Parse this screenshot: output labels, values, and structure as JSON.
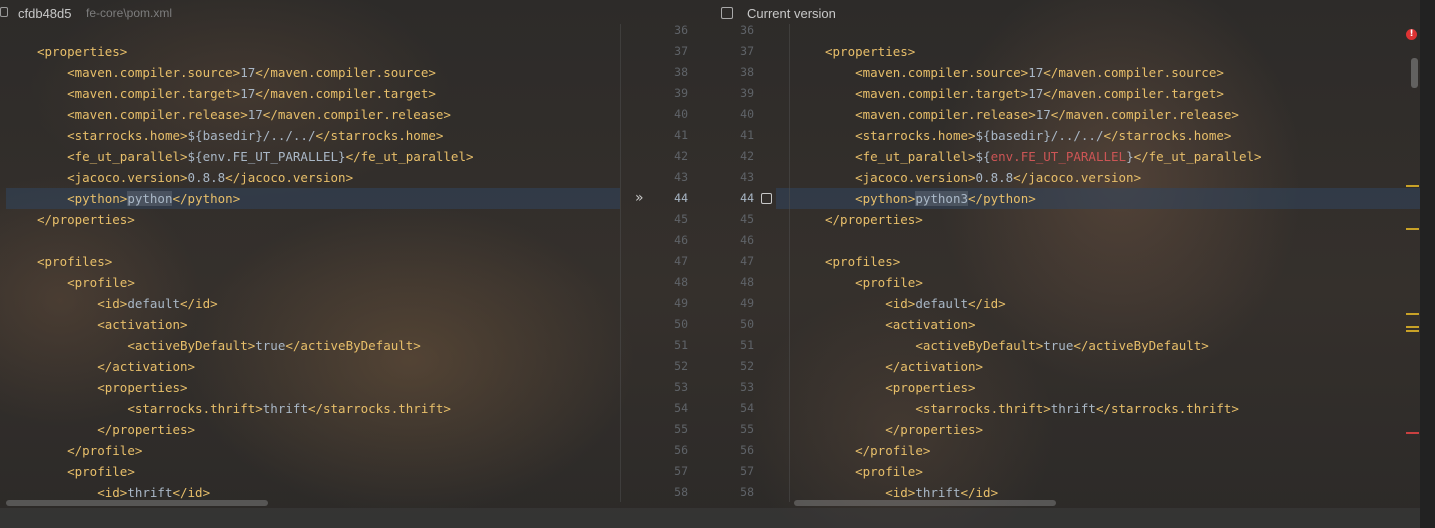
{
  "header": {
    "revision": "cfdb48d5",
    "path": "fe-core\\pom.xml",
    "current_version_label": "Current version"
  },
  "gutter": {
    "left_numbers": [
      "36",
      "37",
      "38",
      "39",
      "40",
      "41",
      "42",
      "43",
      "44",
      "45",
      "46",
      "47",
      "48",
      "49",
      "50",
      "51",
      "52",
      "53",
      "54",
      "55",
      "56",
      "57",
      "58"
    ],
    "right_numbers": [
      "36",
      "37",
      "38",
      "39",
      "40",
      "41",
      "42",
      "43",
      "44",
      "45",
      "46",
      "47",
      "48",
      "49",
      "50",
      "51",
      "52",
      "53",
      "54",
      "55",
      "56",
      "57",
      "58"
    ],
    "current_line": "44"
  },
  "left_lines": [
    {
      "indent": "",
      "parts": []
    },
    {
      "indent": "",
      "parts": [
        {
          "t": "tag",
          "v": "<properties>"
        }
      ]
    },
    {
      "indent": "    ",
      "parts": [
        {
          "t": "tag",
          "v": "<maven.compiler.source>"
        },
        {
          "t": "txt",
          "v": "17"
        },
        {
          "t": "tag",
          "v": "</maven.compiler.source>"
        }
      ]
    },
    {
      "indent": "    ",
      "parts": [
        {
          "t": "tag",
          "v": "<maven.compiler.target>"
        },
        {
          "t": "txt",
          "v": "17"
        },
        {
          "t": "tag",
          "v": "</maven.compiler.target>"
        }
      ]
    },
    {
      "indent": "    ",
      "parts": [
        {
          "t": "tag",
          "v": "<maven.compiler.release>"
        },
        {
          "t": "txt",
          "v": "17"
        },
        {
          "t": "tag",
          "v": "</maven.compiler.release>"
        }
      ]
    },
    {
      "indent": "    ",
      "parts": [
        {
          "t": "tag",
          "v": "<starrocks.home>"
        },
        {
          "t": "txt",
          "v": "${basedir}/../../"
        },
        {
          "t": "tag",
          "v": "</starrocks.home>"
        }
      ]
    },
    {
      "indent": "    ",
      "parts": [
        {
          "t": "tag",
          "v": "<fe_ut_parallel>"
        },
        {
          "t": "txt",
          "v": "${env.FE_UT_PARALLEL}"
        },
        {
          "t": "tag",
          "v": "</fe_ut_parallel>"
        }
      ]
    },
    {
      "indent": "    ",
      "parts": [
        {
          "t": "tag",
          "v": "<jacoco.version>"
        },
        {
          "t": "txt",
          "v": "0.8.8"
        },
        {
          "t": "tag",
          "v": "</jacoco.version>"
        }
      ]
    },
    {
      "indent": "    ",
      "parts": [
        {
          "t": "tag",
          "v": "<python>"
        },
        {
          "t": "nm",
          "v": "python"
        },
        {
          "t": "tag",
          "v": "</python>"
        }
      ]
    },
    {
      "indent": "",
      "parts": [
        {
          "t": "tag",
          "v": "</properties>"
        }
      ]
    },
    {
      "indent": "",
      "parts": []
    },
    {
      "indent": "",
      "parts": [
        {
          "t": "tag",
          "v": "<profiles>"
        }
      ]
    },
    {
      "indent": "    ",
      "parts": [
        {
          "t": "tag",
          "v": "<profile>"
        }
      ]
    },
    {
      "indent": "        ",
      "parts": [
        {
          "t": "tag",
          "v": "<id>"
        },
        {
          "t": "txt",
          "v": "default"
        },
        {
          "t": "tag",
          "v": "</id>"
        }
      ]
    },
    {
      "indent": "        ",
      "parts": [
        {
          "t": "tag",
          "v": "<activation>"
        }
      ]
    },
    {
      "indent": "            ",
      "parts": [
        {
          "t": "tag",
          "v": "<activeByDefault>"
        },
        {
          "t": "txt",
          "v": "true"
        },
        {
          "t": "tag",
          "v": "</activeByDefault>"
        }
      ]
    },
    {
      "indent": "        ",
      "parts": [
        {
          "t": "tag",
          "v": "</activation>"
        }
      ]
    },
    {
      "indent": "        ",
      "parts": [
        {
          "t": "tag",
          "v": "<properties>"
        }
      ]
    },
    {
      "indent": "            ",
      "parts": [
        {
          "t": "tag",
          "v": "<starrocks.thrift>"
        },
        {
          "t": "txt",
          "v": "thrift"
        },
        {
          "t": "tag",
          "v": "</starrocks.thrift>"
        }
      ]
    },
    {
      "indent": "        ",
      "parts": [
        {
          "t": "tag",
          "v": "</properties>"
        }
      ]
    },
    {
      "indent": "    ",
      "parts": [
        {
          "t": "tag",
          "v": "</profile>"
        }
      ]
    },
    {
      "indent": "    ",
      "parts": [
        {
          "t": "tag",
          "v": "<profile>"
        }
      ]
    },
    {
      "indent": "        ",
      "parts": [
        {
          "t": "tag",
          "v": "<id>"
        },
        {
          "t": "txt",
          "v": "thrift"
        },
        {
          "t": "tag",
          "v": "</id>"
        }
      ]
    }
  ],
  "right_lines": [
    {
      "indent": "",
      "parts": []
    },
    {
      "indent": "",
      "parts": [
        {
          "t": "tag",
          "v": "<properties>"
        }
      ]
    },
    {
      "indent": "    ",
      "parts": [
        {
          "t": "tag",
          "v": "<maven.compiler.source>"
        },
        {
          "t": "txt",
          "v": "17"
        },
        {
          "t": "tag",
          "v": "</maven.compiler.source>"
        }
      ]
    },
    {
      "indent": "    ",
      "parts": [
        {
          "t": "tag",
          "v": "<maven.compiler.target>"
        },
        {
          "t": "txt",
          "v": "17"
        },
        {
          "t": "tag",
          "v": "</maven.compiler.target>"
        }
      ]
    },
    {
      "indent": "    ",
      "parts": [
        {
          "t": "tag",
          "v": "<maven.compiler.release>"
        },
        {
          "t": "txt",
          "v": "17"
        },
        {
          "t": "tag",
          "v": "</maven.compiler.release>"
        }
      ]
    },
    {
      "indent": "    ",
      "parts": [
        {
          "t": "tag",
          "v": "<starrocks.home>"
        },
        {
          "t": "txt",
          "v": "${basedir}/../../"
        },
        {
          "t": "tag",
          "v": "</starrocks.home>"
        }
      ]
    },
    {
      "indent": "    ",
      "parts": [
        {
          "t": "tag",
          "v": "<fe_ut_parallel>"
        },
        {
          "t": "txt",
          "v": "${"
        },
        {
          "t": "hl",
          "v": "env.FE_UT_PARALLEL"
        },
        {
          "t": "txt",
          "v": "}"
        },
        {
          "t": "tag",
          "v": "</fe_ut_parallel>"
        }
      ]
    },
    {
      "indent": "    ",
      "parts": [
        {
          "t": "tag",
          "v": "<jacoco.version>"
        },
        {
          "t": "txt",
          "v": "0.8.8"
        },
        {
          "t": "tag",
          "v": "</jacoco.version>"
        }
      ]
    },
    {
      "indent": "    ",
      "parts": [
        {
          "t": "tag",
          "v": "<python>"
        },
        {
          "t": "nm",
          "v": "python3"
        },
        {
          "t": "tag",
          "v": "</python>"
        }
      ]
    },
    {
      "indent": "",
      "parts": [
        {
          "t": "tag",
          "v": "</properties>"
        }
      ]
    },
    {
      "indent": "",
      "parts": []
    },
    {
      "indent": "",
      "parts": [
        {
          "t": "tag",
          "v": "<profiles>"
        }
      ]
    },
    {
      "indent": "    ",
      "parts": [
        {
          "t": "tag",
          "v": "<profile>"
        }
      ]
    },
    {
      "indent": "        ",
      "parts": [
        {
          "t": "tag",
          "v": "<id>"
        },
        {
          "t": "txt",
          "v": "default"
        },
        {
          "t": "tag",
          "v": "</id>"
        }
      ]
    },
    {
      "indent": "        ",
      "parts": [
        {
          "t": "tag",
          "v": "<activation>"
        }
      ]
    },
    {
      "indent": "            ",
      "parts": [
        {
          "t": "tag",
          "v": "<activeByDefault>"
        },
        {
          "t": "txt",
          "v": "true"
        },
        {
          "t": "tag",
          "v": "</activeByDefault>"
        }
      ]
    },
    {
      "indent": "        ",
      "parts": [
        {
          "t": "tag",
          "v": "</activation>"
        }
      ]
    },
    {
      "indent": "        ",
      "parts": [
        {
          "t": "tag",
          "v": "<properties>"
        }
      ]
    },
    {
      "indent": "            ",
      "parts": [
        {
          "t": "tag",
          "v": "<starrocks.thrift>"
        },
        {
          "t": "txt",
          "v": "thrift"
        },
        {
          "t": "tag",
          "v": "</starrocks.thrift>"
        }
      ]
    },
    {
      "indent": "        ",
      "parts": [
        {
          "t": "tag",
          "v": "</properties>"
        }
      ]
    },
    {
      "indent": "    ",
      "parts": [
        {
          "t": "tag",
          "v": "</profile>"
        }
      ]
    },
    {
      "indent": "    ",
      "parts": [
        {
          "t": "tag",
          "v": "<profile>"
        }
      ]
    },
    {
      "indent": "        ",
      "parts": [
        {
          "t": "tag",
          "v": "<id>"
        },
        {
          "t": "txt",
          "v": "thrift"
        },
        {
          "t": "tag",
          "v": "</id>"
        }
      ]
    }
  ],
  "colors": {
    "tag": "#e8bf6a",
    "text": "#a9b7c6",
    "conflict": "#cc5555",
    "marker_change": "#c9a227",
    "marker_error": "#c94040"
  },
  "icons": {
    "lock": "lock-icon",
    "accept_change": "double-chevron-right-icon",
    "error": "error-icon"
  },
  "accept_glyph": "»",
  "error_glyph": "!"
}
